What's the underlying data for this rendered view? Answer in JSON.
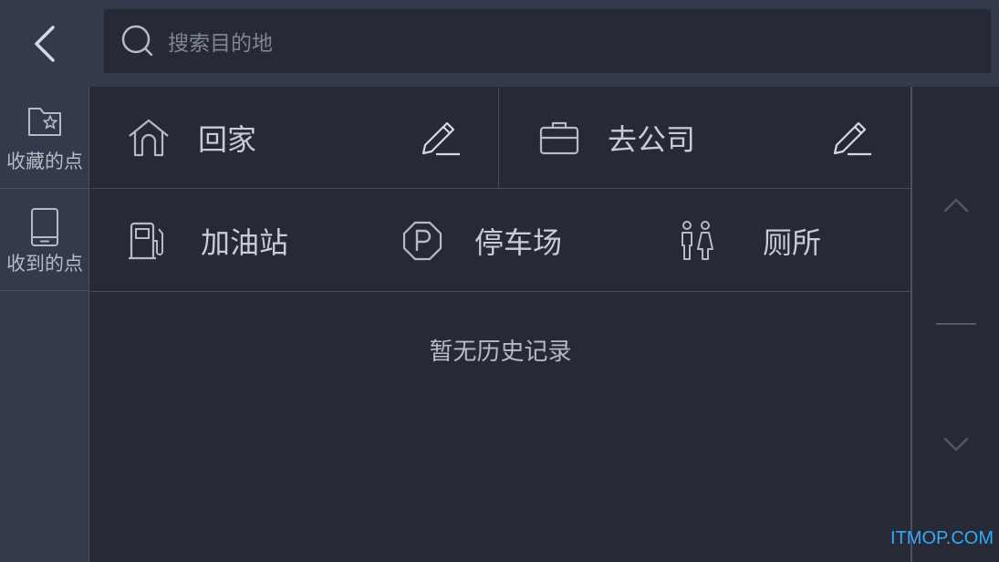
{
  "search": {
    "placeholder": "搜索目的地"
  },
  "sidebar": {
    "items": [
      {
        "label": "收藏的点",
        "icon": "folder-star-icon"
      },
      {
        "label": "收到的点",
        "icon": "phone-icon"
      }
    ]
  },
  "shortcuts": {
    "home": {
      "label": "回家",
      "icon": "home-icon"
    },
    "company": {
      "label": "去公司",
      "icon": "briefcase-icon"
    }
  },
  "categories": [
    {
      "label": "加油站",
      "icon": "gas-station-icon"
    },
    {
      "label": "停车场",
      "icon": "parking-icon"
    },
    {
      "label": "厕所",
      "icon": "toilet-icon"
    }
  ],
  "history": {
    "empty_text": "暂无历史记录"
  },
  "watermark": "ITMOP.COM",
  "colors": {
    "background": "#262a36",
    "panel": "#343a4b",
    "text": "#c9ccd4",
    "watermark": "#3aa8f0"
  }
}
